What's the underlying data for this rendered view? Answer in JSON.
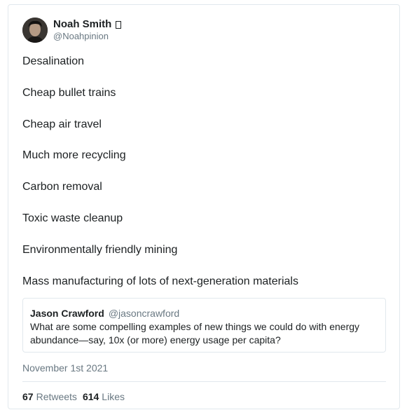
{
  "author": {
    "display_name": "Noah Smith",
    "handle": "@Noahpinion",
    "avatar_icon": "user-avatar-photo",
    "verified_glyph": "missing-glyph-box"
  },
  "tweet": {
    "lines": [
      "Desalination",
      "Cheap bullet trains",
      "Cheap air travel",
      "Much more recycling",
      "Carbon removal",
      "Toxic waste cleanup",
      "Environmentally friendly mining",
      "Mass manufacturing of lots of next-generation materials"
    ]
  },
  "quoted_tweet": {
    "display_name": "Jason Crawford",
    "handle": "@jasoncrawford",
    "text": "What are some compelling examples of new things we could do with energy abundance—say, 10x (or more) energy usage per capita?"
  },
  "date": "November 1st 2021",
  "stats": {
    "retweets_count": "67",
    "retweets_label": "Retweets",
    "likes_count": "614",
    "likes_label": "Likes"
  },
  "colors": {
    "text": "#1c2022",
    "muted": "#697882",
    "border": "#e1e8ed"
  }
}
